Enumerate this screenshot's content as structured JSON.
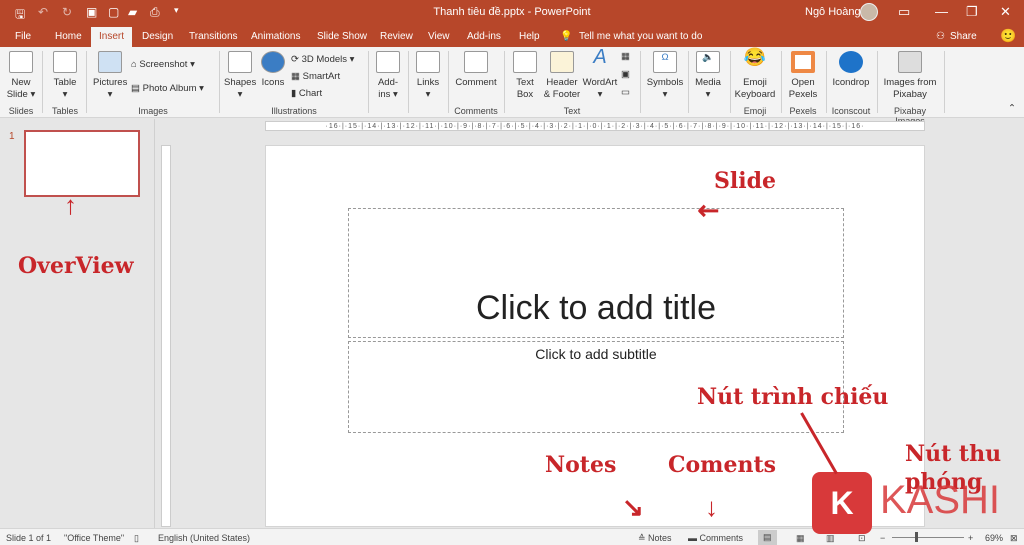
{
  "titlebar": {
    "title": "Thanh tiêu đề.pptx  -  PowerPoint",
    "user": "Ngô Hoàng"
  },
  "tabs": [
    "File",
    "Home",
    "Insert",
    "Design",
    "Transitions",
    "Animations",
    "Slide Show",
    "Review",
    "View",
    "Add-ins",
    "Help"
  ],
  "tell_me": "Tell me what you want to do",
  "share": "Share",
  "ribbon": {
    "new_slide": "New Slide",
    "table": "Table",
    "pictures": "Pictures",
    "screenshot": "Screenshot",
    "photo_album": "Photo Album",
    "shapes": "Shapes",
    "icons": "Icons",
    "models3d": "3D Models",
    "smartart": "SmartArt",
    "chart": "Chart",
    "addins": "Add-ins",
    "links": "Links",
    "comment": "Comment",
    "text_box": "Text Box",
    "header_footer": "Header & Footer",
    "wordart": "WordArt",
    "symbols": "Symbols",
    "media": "Media",
    "emoji_keyboard": "Emoji Keyboard",
    "open_pexels": "Open Pexels",
    "icondrop": "Icondrop",
    "images_pixabay": "Images from Pixabay",
    "groups": {
      "slides": "Slides",
      "tables": "Tables",
      "images": "Images",
      "illustrations": "Illustrations",
      "comments": "Comments",
      "text": "Text",
      "emoji": "Emoji",
      "pexels": "Pexels",
      "iconscout": "Iconscout",
      "pixabay": "Pixabay Images"
    }
  },
  "ruler": "·16·|·15·|·14·|·13·|·12·|·11·|·10·|·9·|·8·|·7·|·6·|·5·|·4·|·3·|·2·|·1·|·0·|·1·|·2·|·3·|·4·|·5·|·6·|·7·|·8·|·9·|·10·|·11·|·12·|·13·|·14·|·15·|·16·",
  "thumb_number": "1",
  "slide": {
    "title_placeholder": "Click to add title",
    "subtitle_placeholder": "Click to add subtitle"
  },
  "status": {
    "slide_count": "Slide 1 of 1",
    "theme": "\"Office Theme\"",
    "language": "English (United States)",
    "notes": "Notes",
    "comments": "Comments",
    "zoom": "69%"
  },
  "annotations": {
    "slide": "Slide",
    "overview": "OverView",
    "present": "Nút trình chiếu",
    "notes": "Notes",
    "comments": "Coments",
    "zoom": "Nút thu phóng",
    "logo": "KASHI",
    "logo_k": "K"
  },
  "colors": {
    "accent": "#b7472a",
    "annotation": "#c8262a"
  }
}
